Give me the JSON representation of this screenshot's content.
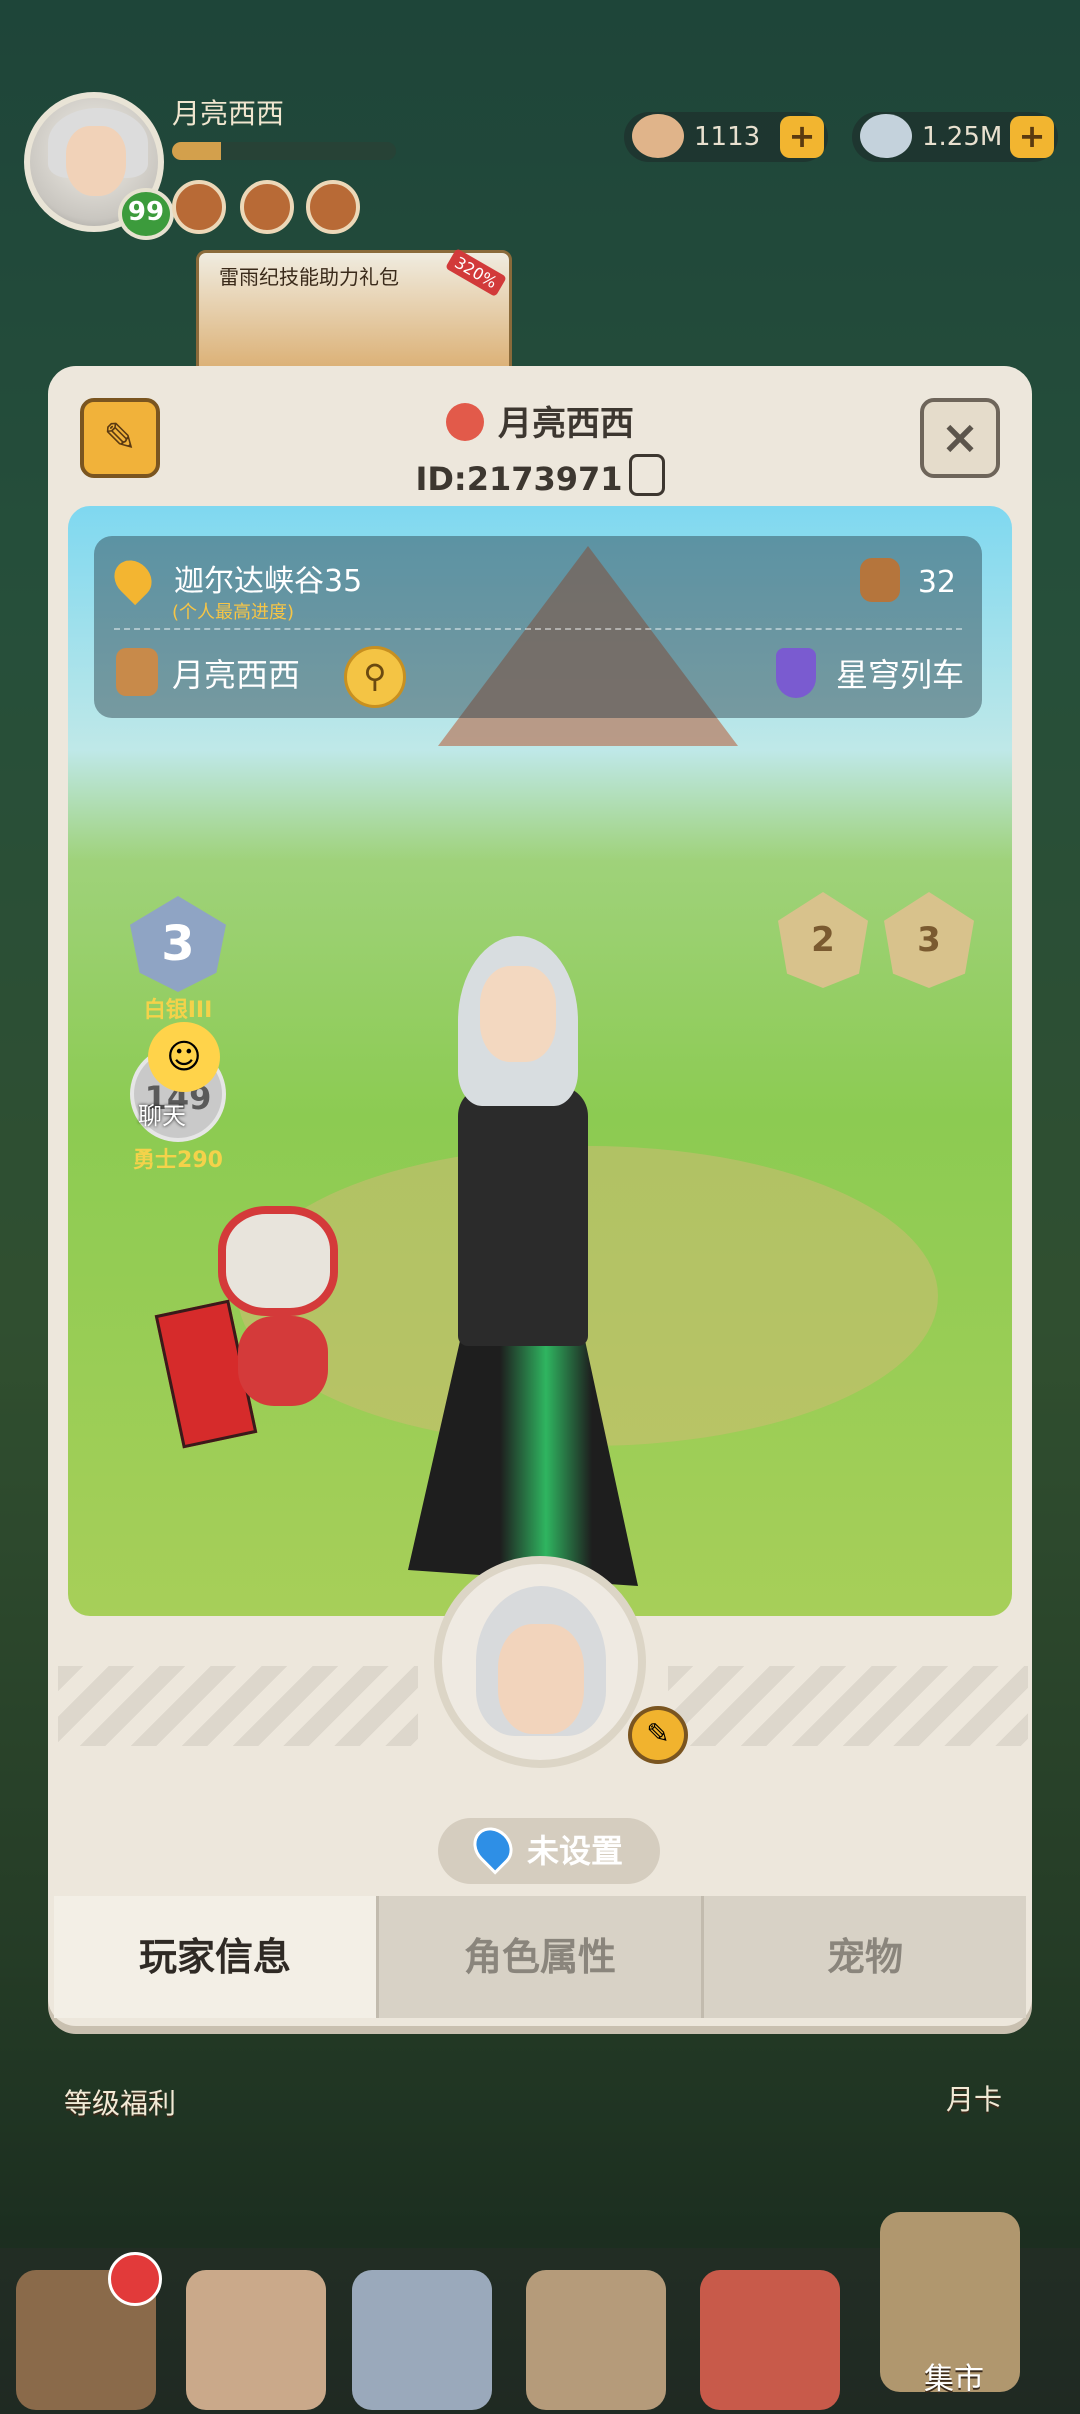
{
  "hud": {
    "player_name": "月亮西西",
    "level": "99",
    "xp_fraction": 0.22,
    "resource1_value": "1113",
    "resource2_value": "1.25M",
    "plus_label": "+",
    "promo_title": "雷雨纪技能助力礼包",
    "promo_tag": "320%"
  },
  "dialog": {
    "title_name": "月亮西西",
    "id_text": "ID:2173971",
    "close_label": "×",
    "info": {
      "location": "迦尔达峡谷35",
      "location_sub": "(个人最高进度)",
      "likes": "32",
      "guild": "月亮西西",
      "server": "星穹列车"
    },
    "rank": {
      "num": "3",
      "label": "白银III"
    },
    "power": {
      "value": "149",
      "label": "勇士290"
    },
    "chat_label": "聊天",
    "medals": [
      "2",
      "3"
    ],
    "location_setting": "未设置",
    "tabs": [
      "玩家信息",
      "角色属性",
      "宠物"
    ]
  },
  "background": {
    "level_reward": "等级福利",
    "month_card": "月卡",
    "market": "集市"
  },
  "icons": [
    "edit-icon",
    "key-icon",
    "copy-icon",
    "pin-icon",
    "likes-icon",
    "guild-icon",
    "search-icon",
    "server-icon",
    "rank-icon",
    "chat-icon",
    "medal-icon",
    "pencil-icon"
  ]
}
